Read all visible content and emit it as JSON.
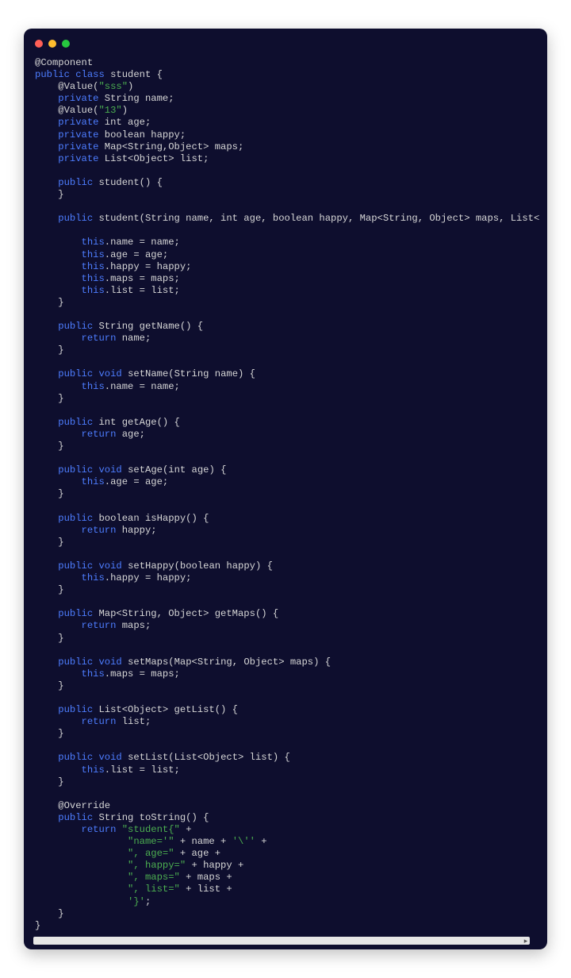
{
  "window": {
    "dots": [
      "red",
      "yellow",
      "green"
    ]
  },
  "code": {
    "lines": [
      {
        "indent": 0,
        "parts": [
          {
            "t": "ann",
            "v": "@Component"
          }
        ]
      },
      {
        "indent": 0,
        "parts": [
          {
            "t": "kw",
            "v": "public"
          },
          {
            "t": "pl",
            "v": " "
          },
          {
            "t": "kw",
            "v": "class"
          },
          {
            "t": "pl",
            "v": " student {"
          }
        ]
      },
      {
        "indent": 1,
        "parts": [
          {
            "t": "pl",
            "v": "@Value("
          },
          {
            "t": "str",
            "v": "\"sss\""
          },
          {
            "t": "pl",
            "v": ")"
          }
        ]
      },
      {
        "indent": 1,
        "parts": [
          {
            "t": "kw",
            "v": "private"
          },
          {
            "t": "pl",
            "v": " String name;"
          }
        ]
      },
      {
        "indent": 1,
        "parts": [
          {
            "t": "pl",
            "v": "@Value("
          },
          {
            "t": "str",
            "v": "\"13\""
          },
          {
            "t": "pl",
            "v": ")"
          }
        ]
      },
      {
        "indent": 1,
        "parts": [
          {
            "t": "kw",
            "v": "private"
          },
          {
            "t": "pl",
            "v": " int age;"
          }
        ]
      },
      {
        "indent": 1,
        "parts": [
          {
            "t": "kw",
            "v": "private"
          },
          {
            "t": "pl",
            "v": " boolean happy;"
          }
        ]
      },
      {
        "indent": 1,
        "parts": [
          {
            "t": "kw",
            "v": "private"
          },
          {
            "t": "pl",
            "v": " Map<String,Object> maps;"
          }
        ]
      },
      {
        "indent": 1,
        "parts": [
          {
            "t": "kw",
            "v": "private"
          },
          {
            "t": "pl",
            "v": " List<Object> list;"
          }
        ]
      },
      {
        "indent": 0,
        "parts": [
          {
            "t": "pl",
            "v": ""
          }
        ]
      },
      {
        "indent": 1,
        "parts": [
          {
            "t": "kw",
            "v": "public"
          },
          {
            "t": "pl",
            "v": " student() {"
          }
        ]
      },
      {
        "indent": 1,
        "parts": [
          {
            "t": "pl",
            "v": "}"
          }
        ]
      },
      {
        "indent": 0,
        "parts": [
          {
            "t": "pl",
            "v": ""
          }
        ]
      },
      {
        "indent": 1,
        "parts": [
          {
            "t": "kw",
            "v": "public"
          },
          {
            "t": "pl",
            "v": " student(String name, int age, boolean happy, Map<String, Object> maps, List<Object> list) {"
          }
        ]
      },
      {
        "indent": 0,
        "parts": [
          {
            "t": "pl",
            "v": ""
          }
        ]
      },
      {
        "indent": 2,
        "parts": [
          {
            "t": "kw",
            "v": "this"
          },
          {
            "t": "pl",
            "v": ".name = name;"
          }
        ]
      },
      {
        "indent": 2,
        "parts": [
          {
            "t": "kw",
            "v": "this"
          },
          {
            "t": "pl",
            "v": ".age = age;"
          }
        ]
      },
      {
        "indent": 2,
        "parts": [
          {
            "t": "kw",
            "v": "this"
          },
          {
            "t": "pl",
            "v": ".happy = happy;"
          }
        ]
      },
      {
        "indent": 2,
        "parts": [
          {
            "t": "kw",
            "v": "this"
          },
          {
            "t": "pl",
            "v": ".maps = maps;"
          }
        ]
      },
      {
        "indent": 2,
        "parts": [
          {
            "t": "kw",
            "v": "this"
          },
          {
            "t": "pl",
            "v": ".list = list;"
          }
        ]
      },
      {
        "indent": 1,
        "parts": [
          {
            "t": "pl",
            "v": "}"
          }
        ]
      },
      {
        "indent": 0,
        "parts": [
          {
            "t": "pl",
            "v": ""
          }
        ]
      },
      {
        "indent": 1,
        "parts": [
          {
            "t": "kw",
            "v": "public"
          },
          {
            "t": "pl",
            "v": " String getName() {"
          }
        ]
      },
      {
        "indent": 2,
        "parts": [
          {
            "t": "kw",
            "v": "return"
          },
          {
            "t": "pl",
            "v": " name;"
          }
        ]
      },
      {
        "indent": 1,
        "parts": [
          {
            "t": "pl",
            "v": "}"
          }
        ]
      },
      {
        "indent": 0,
        "parts": [
          {
            "t": "pl",
            "v": ""
          }
        ]
      },
      {
        "indent": 1,
        "parts": [
          {
            "t": "kw",
            "v": "public"
          },
          {
            "t": "pl",
            "v": " "
          },
          {
            "t": "kw",
            "v": "void"
          },
          {
            "t": "pl",
            "v": " setName(String name) {"
          }
        ]
      },
      {
        "indent": 2,
        "parts": [
          {
            "t": "kw",
            "v": "this"
          },
          {
            "t": "pl",
            "v": ".name = name;"
          }
        ]
      },
      {
        "indent": 1,
        "parts": [
          {
            "t": "pl",
            "v": "}"
          }
        ]
      },
      {
        "indent": 0,
        "parts": [
          {
            "t": "pl",
            "v": ""
          }
        ]
      },
      {
        "indent": 1,
        "parts": [
          {
            "t": "kw",
            "v": "public"
          },
          {
            "t": "pl",
            "v": " int getAge() {"
          }
        ]
      },
      {
        "indent": 2,
        "parts": [
          {
            "t": "kw",
            "v": "return"
          },
          {
            "t": "pl",
            "v": " age;"
          }
        ]
      },
      {
        "indent": 1,
        "parts": [
          {
            "t": "pl",
            "v": "}"
          }
        ]
      },
      {
        "indent": 0,
        "parts": [
          {
            "t": "pl",
            "v": ""
          }
        ]
      },
      {
        "indent": 1,
        "parts": [
          {
            "t": "kw",
            "v": "public"
          },
          {
            "t": "pl",
            "v": " "
          },
          {
            "t": "kw",
            "v": "void"
          },
          {
            "t": "pl",
            "v": " setAge(int age) {"
          }
        ]
      },
      {
        "indent": 2,
        "parts": [
          {
            "t": "kw",
            "v": "this"
          },
          {
            "t": "pl",
            "v": ".age = age;"
          }
        ]
      },
      {
        "indent": 1,
        "parts": [
          {
            "t": "pl",
            "v": "}"
          }
        ]
      },
      {
        "indent": 0,
        "parts": [
          {
            "t": "pl",
            "v": ""
          }
        ]
      },
      {
        "indent": 1,
        "parts": [
          {
            "t": "kw",
            "v": "public"
          },
          {
            "t": "pl",
            "v": " boolean isHappy() {"
          }
        ]
      },
      {
        "indent": 2,
        "parts": [
          {
            "t": "kw",
            "v": "return"
          },
          {
            "t": "pl",
            "v": " happy;"
          }
        ]
      },
      {
        "indent": 1,
        "parts": [
          {
            "t": "pl",
            "v": "}"
          }
        ]
      },
      {
        "indent": 0,
        "parts": [
          {
            "t": "pl",
            "v": ""
          }
        ]
      },
      {
        "indent": 1,
        "parts": [
          {
            "t": "kw",
            "v": "public"
          },
          {
            "t": "pl",
            "v": " "
          },
          {
            "t": "kw",
            "v": "void"
          },
          {
            "t": "pl",
            "v": " setHappy(boolean happy) {"
          }
        ]
      },
      {
        "indent": 2,
        "parts": [
          {
            "t": "kw",
            "v": "this"
          },
          {
            "t": "pl",
            "v": ".happy = happy;"
          }
        ]
      },
      {
        "indent": 1,
        "parts": [
          {
            "t": "pl",
            "v": "}"
          }
        ]
      },
      {
        "indent": 0,
        "parts": [
          {
            "t": "pl",
            "v": ""
          }
        ]
      },
      {
        "indent": 1,
        "parts": [
          {
            "t": "kw",
            "v": "public"
          },
          {
            "t": "pl",
            "v": " Map<String, Object> getMaps() {"
          }
        ]
      },
      {
        "indent": 2,
        "parts": [
          {
            "t": "kw",
            "v": "return"
          },
          {
            "t": "pl",
            "v": " maps;"
          }
        ]
      },
      {
        "indent": 1,
        "parts": [
          {
            "t": "pl",
            "v": "}"
          }
        ]
      },
      {
        "indent": 0,
        "parts": [
          {
            "t": "pl",
            "v": ""
          }
        ]
      },
      {
        "indent": 1,
        "parts": [
          {
            "t": "kw",
            "v": "public"
          },
          {
            "t": "pl",
            "v": " "
          },
          {
            "t": "kw",
            "v": "void"
          },
          {
            "t": "pl",
            "v": " setMaps(Map<String, Object> maps) {"
          }
        ]
      },
      {
        "indent": 2,
        "parts": [
          {
            "t": "kw",
            "v": "this"
          },
          {
            "t": "pl",
            "v": ".maps = maps;"
          }
        ]
      },
      {
        "indent": 1,
        "parts": [
          {
            "t": "pl",
            "v": "}"
          }
        ]
      },
      {
        "indent": 0,
        "parts": [
          {
            "t": "pl",
            "v": ""
          }
        ]
      },
      {
        "indent": 1,
        "parts": [
          {
            "t": "kw",
            "v": "public"
          },
          {
            "t": "pl",
            "v": " List<Object> getList() {"
          }
        ]
      },
      {
        "indent": 2,
        "parts": [
          {
            "t": "kw",
            "v": "return"
          },
          {
            "t": "pl",
            "v": " list;"
          }
        ]
      },
      {
        "indent": 1,
        "parts": [
          {
            "t": "pl",
            "v": "}"
          }
        ]
      },
      {
        "indent": 0,
        "parts": [
          {
            "t": "pl",
            "v": ""
          }
        ]
      },
      {
        "indent": 1,
        "parts": [
          {
            "t": "kw",
            "v": "public"
          },
          {
            "t": "pl",
            "v": " "
          },
          {
            "t": "kw",
            "v": "void"
          },
          {
            "t": "pl",
            "v": " setList(List<Object> list) {"
          }
        ]
      },
      {
        "indent": 2,
        "parts": [
          {
            "t": "kw",
            "v": "this"
          },
          {
            "t": "pl",
            "v": ".list = list;"
          }
        ]
      },
      {
        "indent": 1,
        "parts": [
          {
            "t": "pl",
            "v": "}"
          }
        ]
      },
      {
        "indent": 0,
        "parts": [
          {
            "t": "pl",
            "v": ""
          }
        ]
      },
      {
        "indent": 1,
        "parts": [
          {
            "t": "ann",
            "v": "@Override"
          }
        ]
      },
      {
        "indent": 1,
        "parts": [
          {
            "t": "kw",
            "v": "public"
          },
          {
            "t": "pl",
            "v": " String toString() {"
          }
        ]
      },
      {
        "indent": 2,
        "parts": [
          {
            "t": "kw",
            "v": "return"
          },
          {
            "t": "pl",
            "v": " "
          },
          {
            "t": "str",
            "v": "\"student{\""
          },
          {
            "t": "pl",
            "v": " +"
          }
        ]
      },
      {
        "indent": 4,
        "parts": [
          {
            "t": "str",
            "v": "\"name='\""
          },
          {
            "t": "pl",
            "v": " + name + "
          },
          {
            "t": "str",
            "v": "'\\''"
          },
          {
            "t": "pl",
            "v": " +"
          }
        ]
      },
      {
        "indent": 4,
        "parts": [
          {
            "t": "str",
            "v": "\", age=\""
          },
          {
            "t": "pl",
            "v": " + age +"
          }
        ]
      },
      {
        "indent": 4,
        "parts": [
          {
            "t": "str",
            "v": "\", happy=\""
          },
          {
            "t": "pl",
            "v": " + happy +"
          }
        ]
      },
      {
        "indent": 4,
        "parts": [
          {
            "t": "str",
            "v": "\", maps=\""
          },
          {
            "t": "pl",
            "v": " + maps +"
          }
        ]
      },
      {
        "indent": 4,
        "parts": [
          {
            "t": "str",
            "v": "\", list=\""
          },
          {
            "t": "pl",
            "v": " + list +"
          }
        ]
      },
      {
        "indent": 4,
        "parts": [
          {
            "t": "str",
            "v": "'}'"
          },
          {
            "t": "pl",
            "v": ";"
          }
        ]
      },
      {
        "indent": 1,
        "parts": [
          {
            "t": "pl",
            "v": "}"
          }
        ]
      },
      {
        "indent": 0,
        "parts": [
          {
            "t": "pl",
            "v": "}"
          }
        ]
      }
    ],
    "indent_unit": "    "
  }
}
